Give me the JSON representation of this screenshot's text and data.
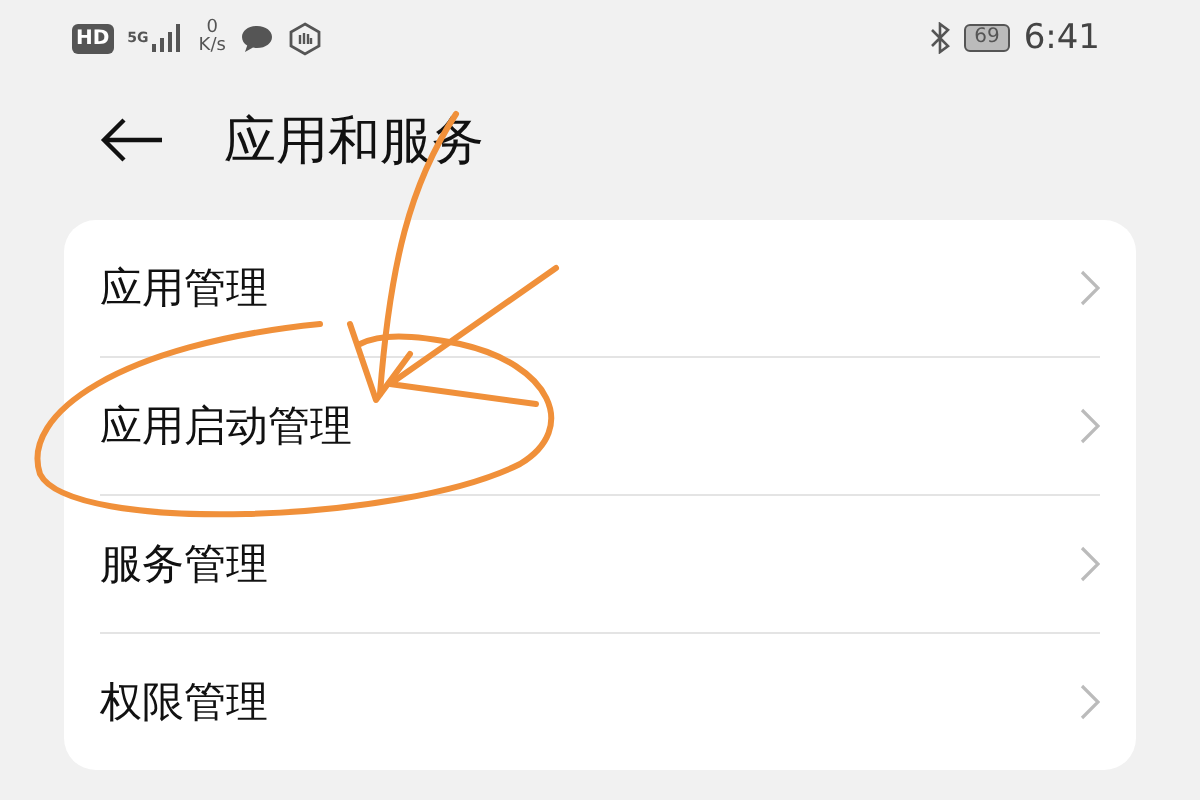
{
  "status_bar": {
    "hd": "HD",
    "network": "5G",
    "speed_value": "0",
    "speed_unit": "K/s",
    "battery": "69",
    "time": "6:41"
  },
  "header": {
    "title": "应用和服务"
  },
  "items": [
    {
      "label": "应用管理"
    },
    {
      "label": "应用启动管理"
    },
    {
      "label": "服务管理"
    },
    {
      "label": "权限管理"
    }
  ]
}
